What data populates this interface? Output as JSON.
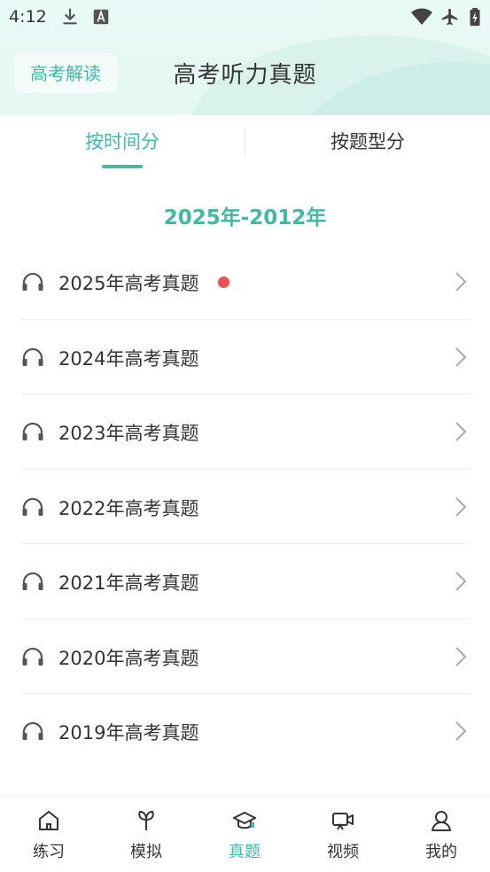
{
  "status_bar": {
    "time": "4:12",
    "icons": [
      "download-icon",
      "a-icon",
      "wifi-icon",
      "airplane-icon",
      "battery-charging-icon"
    ]
  },
  "header": {
    "badge": "高考解读",
    "title": "高考听力真题"
  },
  "tabs": [
    {
      "label": "按时间分",
      "active": true
    },
    {
      "label": "按题型分",
      "active": false
    }
  ],
  "section": {
    "heading": "2025年-2012年"
  },
  "items": [
    {
      "label": "2025年高考真题",
      "new": true
    },
    {
      "label": "2024年高考真题",
      "new": false
    },
    {
      "label": "2023年高考真题",
      "new": false
    },
    {
      "label": "2022年高考真题",
      "new": false
    },
    {
      "label": "2021年高考真题",
      "new": false
    },
    {
      "label": "2020年高考真题",
      "new": false
    },
    {
      "label": "2019年高考真题",
      "new": false
    }
  ],
  "bottom_nav": [
    {
      "label": "练习",
      "icon": "home-icon",
      "active": false
    },
    {
      "label": "模拟",
      "icon": "leaf-icon",
      "active": false
    },
    {
      "label": "真题",
      "icon": "graduation-cap-icon",
      "active": true
    },
    {
      "label": "视频",
      "icon": "video-icon",
      "active": false
    },
    {
      "label": "我的",
      "icon": "user-icon",
      "active": false
    }
  ],
  "colors": {
    "accent": "#3fbaa9",
    "badge_dot": "#e85450",
    "text": "#333333",
    "header_bg": "#e4f7f2"
  }
}
